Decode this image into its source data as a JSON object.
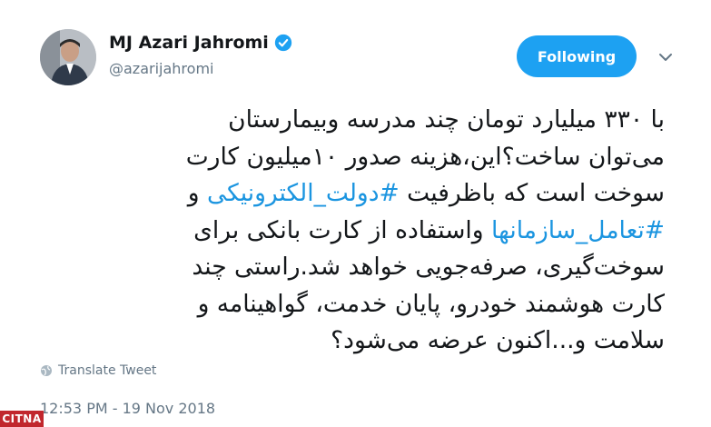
{
  "profile": {
    "name": "MJ Azari Jahromi",
    "handle": "@azarijahromi"
  },
  "follow_button": {
    "label": "Following"
  },
  "tweet": {
    "line1": "با ۳۳۰ میلیارد تومان چند مدرسه وبیمارستان",
    "line2": "می‌توان ساخت؟این،هزینه صدور ۱۰میلیون کارت",
    "line3_prefix": "سوخت است که باظرفیت",
    "hashtag1": "#دولت_الکترونیکی",
    "line3_suffix": "و",
    "hashtag2": "#تعامل_سازمانها",
    "line4_suffix": "واستفاده از کارت بانکی برای",
    "line5": "سوخت‌گیری، صرفه‌جویی خواهد شد.راستی چند",
    "line6": "کارت هوشمند خودرو، پایان خدمت، گواهینامه و",
    "line7": "سلامت و...اکنون عرضه می‌شود؟"
  },
  "translate_label": "Translate Tweet",
  "timestamp": "12:53 PM - 19 Nov 2018",
  "watermark": "CITNA",
  "colors": {
    "accent": "#1da1f2",
    "hashtag": "#1b95e0",
    "text": "#14171a",
    "muted": "#657786"
  },
  "icons": {
    "verified": "verified-badge-icon",
    "chevron": "chevron-down-icon",
    "globe": "globe-icon"
  }
}
